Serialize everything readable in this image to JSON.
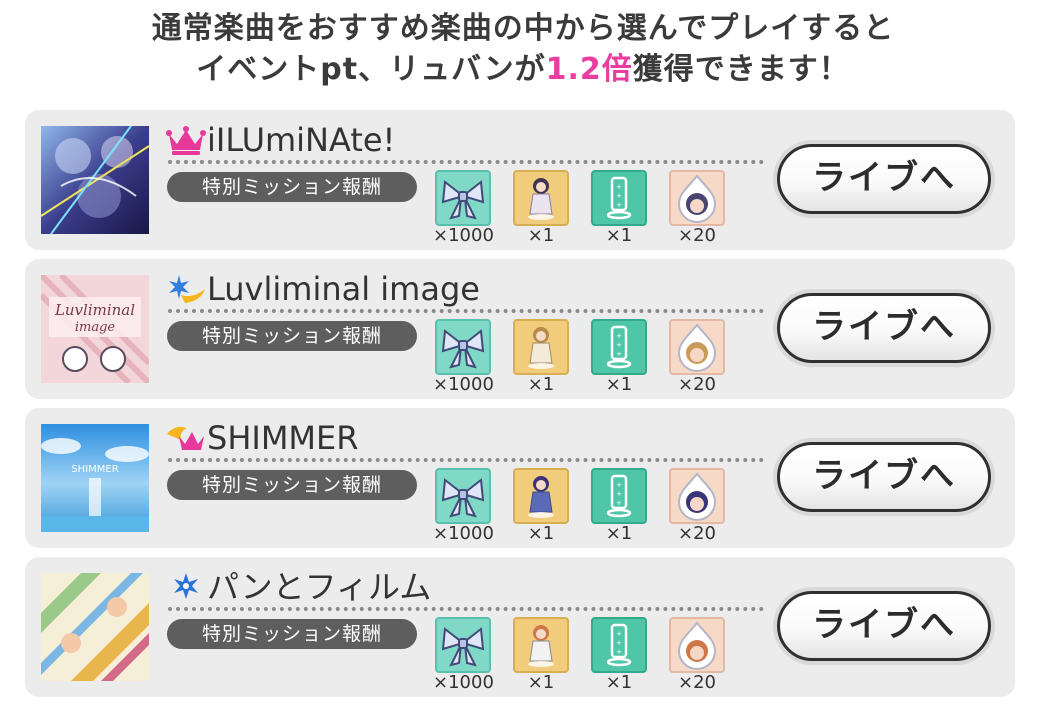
{
  "header": {
    "line1": "通常楽曲をおすすめ楽曲の中から選んでプレイすると",
    "line2_prefix": "イベントpt、リュバンが",
    "line2_highlight": "1.2倍",
    "line2_suffix": "獲得できます！",
    "highlight_color": "#e93ea0"
  },
  "mission_label": "特別ミッション報酬",
  "live_button_label": "ライブへ",
  "songs": [
    {
      "title": "iILUmiNAte!",
      "type_icon": "pink-crown-icon",
      "type_color": "#e8399b",
      "rewards": [
        {
          "icon": "ribbon-icon",
          "count": "×1000"
        },
        {
          "icon": "acrylic-stand-icon",
          "count": "×1"
        },
        {
          "icon": "stand-base-icon",
          "count": "×1"
        },
        {
          "icon": "idol-piece-icon",
          "count": "×20"
        }
      ]
    },
    {
      "title": "Luvliminal image",
      "type_icon": "blue-star-wing-icon",
      "type_color": "#2f7fe0",
      "rewards": [
        {
          "icon": "ribbon-icon",
          "count": "×1000"
        },
        {
          "icon": "acrylic-stand-icon",
          "count": "×1"
        },
        {
          "icon": "stand-base-icon",
          "count": "×1"
        },
        {
          "icon": "idol-piece-icon",
          "count": "×20"
        }
      ]
    },
    {
      "title": "SHIMMER",
      "type_icon": "yellow-wing-crown-icon",
      "type_color": "#f4b61c",
      "rewards": [
        {
          "icon": "ribbon-icon",
          "count": "×1000"
        },
        {
          "icon": "acrylic-stand-icon",
          "count": "×1"
        },
        {
          "icon": "stand-base-icon",
          "count": "×1"
        },
        {
          "icon": "idol-piece-icon",
          "count": "×20"
        }
      ]
    },
    {
      "title": "パンとフィルム",
      "type_icon": "blue-snowflake-icon",
      "type_color": "#2a73d8",
      "rewards": [
        {
          "icon": "ribbon-icon",
          "count": "×1000"
        },
        {
          "icon": "acrylic-stand-icon",
          "count": "×1"
        },
        {
          "icon": "stand-base-icon",
          "count": "×1"
        },
        {
          "icon": "idol-piece-icon",
          "count": "×20"
        }
      ]
    }
  ]
}
